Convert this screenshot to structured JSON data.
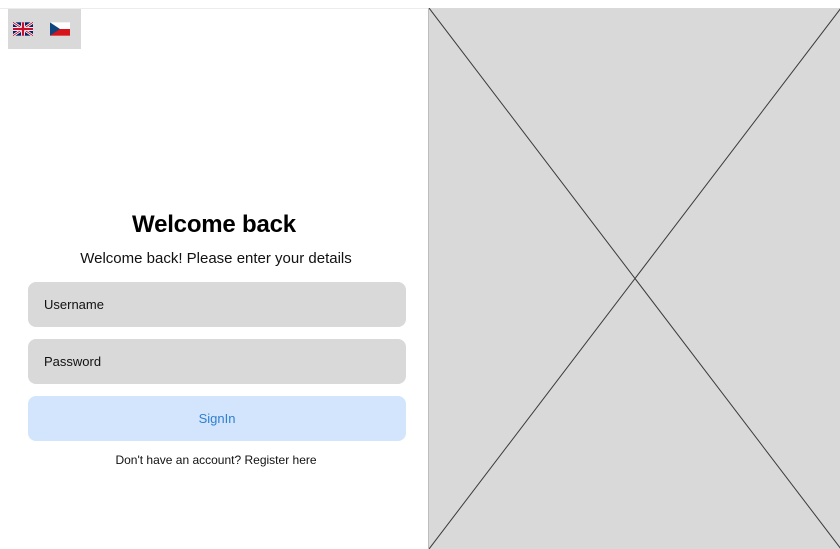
{
  "language_switcher": {
    "options": [
      {
        "code": "en",
        "icon": "uk-flag-icon"
      },
      {
        "code": "cs",
        "icon": "czech-flag-icon"
      }
    ]
  },
  "login": {
    "title": "Welcome back",
    "subtitle": "Welcome back! Please enter your details",
    "username_placeholder": "Username",
    "password_placeholder": "Password",
    "signin_label": "SignIn",
    "register_text": "Don't have an account? Register here"
  },
  "image_placeholder": {
    "icon": "image-placeholder-cross"
  },
  "colors": {
    "field_background": "#d9d9d9",
    "button_background": "#d3e5fc",
    "button_text": "#2f7fd1",
    "panel_background": "#d9d9d9"
  }
}
